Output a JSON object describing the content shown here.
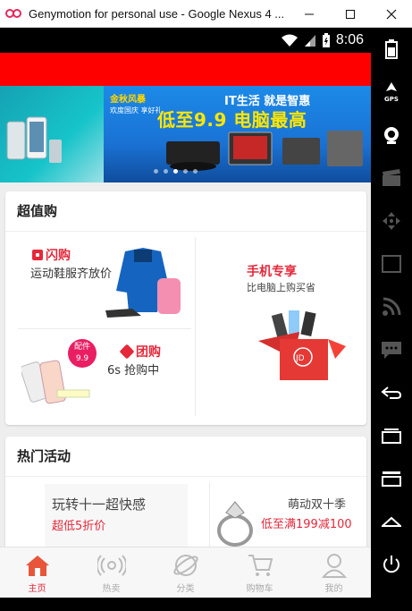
{
  "window": {
    "title": "Genymotion for personal use - Google Nexus 4 ...",
    "icon": "genymotion-logo-icon"
  },
  "statusbar": {
    "time": "8:06",
    "icons": [
      "wifi-icon",
      "signal-icon",
      "battery-icon"
    ]
  },
  "banner": {
    "promo_title": "金秋风暴",
    "promo_sub": "欢度国庆 享好礼",
    "it_headline": "IT生活 就是智惠",
    "sale_text": "低至9.9 电脑最高",
    "active_slide": 3,
    "slide_count": 5
  },
  "deals": {
    "title": "超值购",
    "flash": {
      "label": "闪购",
      "sub": "运动鞋服齐放价"
    },
    "phone": {
      "label": "手机专享",
      "sub": "比电脑上购买省"
    },
    "group": {
      "label": "团购",
      "sub": "6s 抢购中",
      "badge_line1": "配件",
      "badge_line2": "9.9"
    },
    "jd_logo": "JD"
  },
  "hot": {
    "title": "热门活动",
    "item_a": {
      "title": "玩转十一超快感",
      "sub": "超低5折价"
    },
    "item_b": {
      "title": "萌动双十季",
      "sub": "低至满199减100"
    }
  },
  "tabs": [
    {
      "label": "主页",
      "icon": "home-icon",
      "active": true
    },
    {
      "label": "热卖",
      "icon": "broadcast-icon",
      "active": false
    },
    {
      "label": "分类",
      "icon": "planet-icon",
      "active": false
    },
    {
      "label": "购物车",
      "icon": "cart-icon",
      "active": false
    },
    {
      "label": "我的",
      "icon": "user-icon",
      "active": false
    }
  ],
  "sidetool": {
    "gps_label": "GPS",
    "id_label": "ID"
  },
  "colors": {
    "brand_red": "#ff0000",
    "accent_red": "#e5283a",
    "badge_pink": "#e91e63"
  }
}
